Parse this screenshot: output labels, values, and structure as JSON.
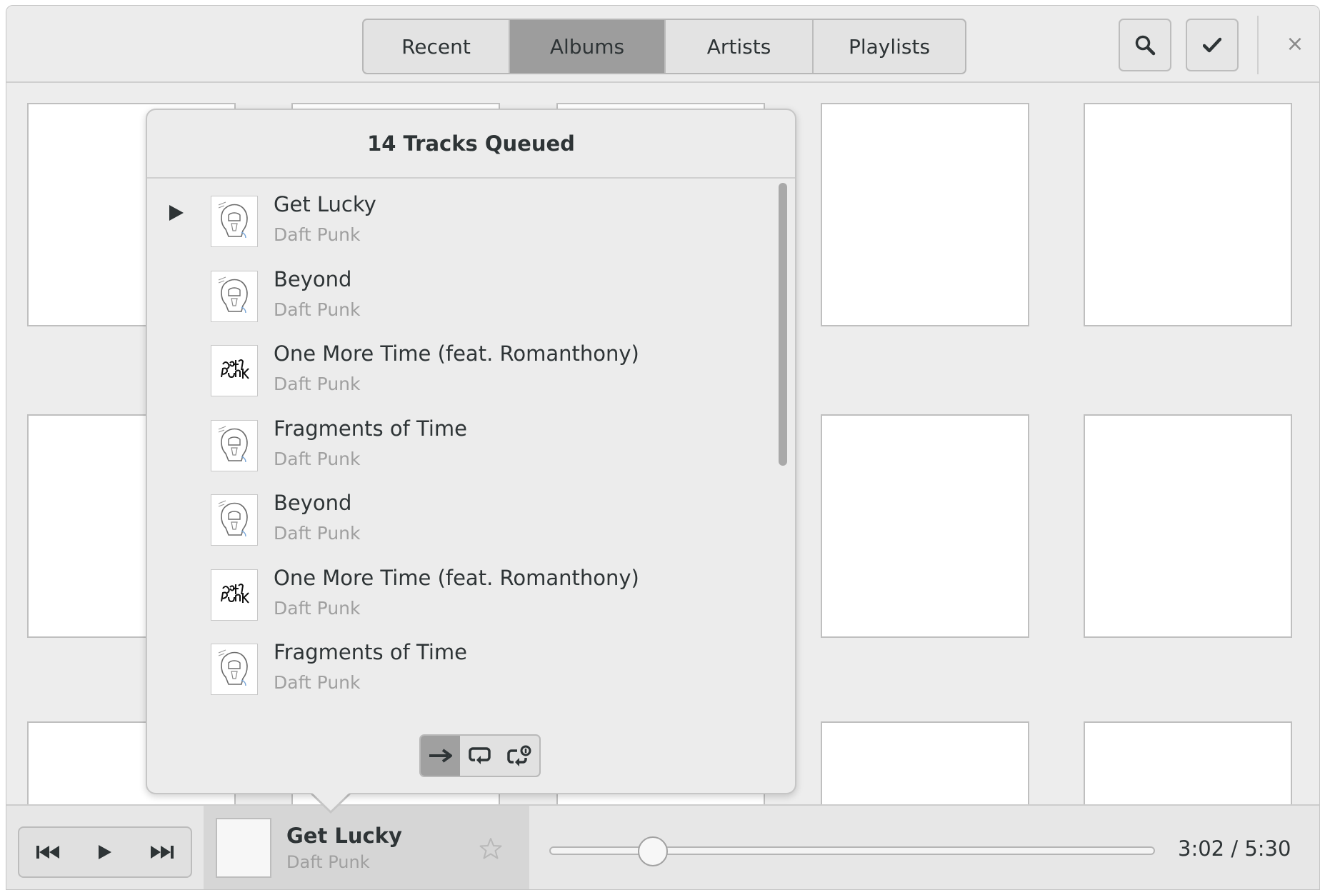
{
  "header": {
    "tabs": [
      {
        "label": "Recent",
        "active": false
      },
      {
        "label": "Albums",
        "active": true
      },
      {
        "label": "Artists",
        "active": false
      },
      {
        "label": "Playlists",
        "active": false
      }
    ],
    "buttons": {
      "search": "search-icon",
      "select": "checkmark-icon",
      "close": "×"
    }
  },
  "queue": {
    "title": "14 Tracks Queued",
    "tracks": [
      {
        "title": "Get Lucky",
        "artist": "Daft Punk",
        "art": "helmet",
        "playing": true
      },
      {
        "title": "Beyond",
        "artist": "Daft Punk",
        "art": "helmet",
        "playing": false
      },
      {
        "title": "One More Time (feat. Romanthony)",
        "artist": "Daft Punk",
        "art": "logo",
        "playing": false
      },
      {
        "title": "Fragments of Time",
        "artist": "Daft Punk",
        "art": "helmet",
        "playing": false
      },
      {
        "title": "Beyond",
        "artist": "Daft Punk",
        "art": "helmet",
        "playing": false
      },
      {
        "title": "One More Time (feat. Romanthony)",
        "artist": "Daft Punk",
        "art": "logo",
        "playing": false
      },
      {
        "title": "Fragments of Time",
        "artist": "Daft Punk",
        "art": "helmet",
        "playing": false
      }
    ],
    "repeat_modes": [
      {
        "icon": "no-repeat-arrow-icon",
        "active": true
      },
      {
        "icon": "repeat-all-icon",
        "active": false
      },
      {
        "icon": "repeat-one-icon",
        "active": false
      }
    ]
  },
  "player": {
    "title": "Get Lucky",
    "artist": "Daft Punk",
    "time": "3:02 / 5:30",
    "progress": 0.17,
    "controls": [
      "previous-icon",
      "play-icon",
      "next-icon"
    ]
  },
  "colors": {
    "active_tab": "#9d9d9d",
    "background": "#ededed",
    "secondary_text": "#a0a0a0"
  }
}
